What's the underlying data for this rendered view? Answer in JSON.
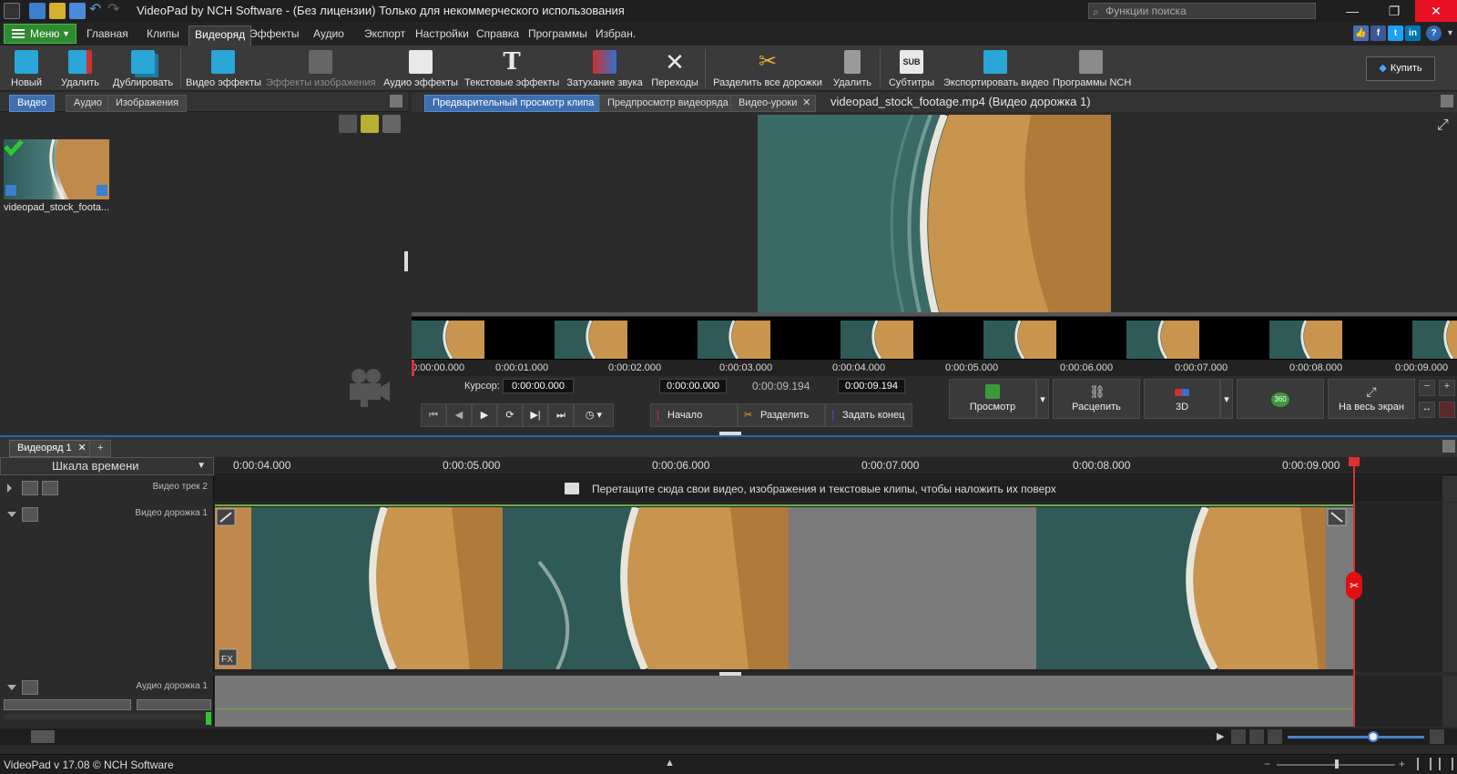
{
  "window": {
    "title": "VideoPad by NCH Software - (Без лицензии) Только для некоммерческого использования",
    "search_placeholder": "Функции поиска"
  },
  "menu": {
    "menu_button": "Меню",
    "tabs": [
      "Главная",
      "Клипы",
      "Видеоряд",
      "Эффекты",
      "Аудио",
      "Экспорт",
      "Настройки",
      "Справка",
      "Программы",
      "Избран."
    ],
    "active_tab": "Видеоряд"
  },
  "toolbar": {
    "items": [
      {
        "label": "Новый",
        "icon": "new-icon",
        "enabled": true
      },
      {
        "label": "Удалить",
        "icon": "delete-icon",
        "enabled": true
      },
      {
        "label": "Дублировать",
        "icon": "duplicate-icon",
        "enabled": true
      },
      {
        "label": "Видео эффекты",
        "icon": "video-effects-icon",
        "enabled": true
      },
      {
        "label": "Эффекты изображения",
        "icon": "image-effects-icon",
        "enabled": false
      },
      {
        "label": "Аудио эффекты",
        "icon": "audio-effects-icon",
        "enabled": true
      },
      {
        "label": "Текстовые эффекты",
        "icon": "text-effects-icon",
        "enabled": true
      },
      {
        "label": "Затухание звука",
        "icon": "fade-icon",
        "enabled": true
      },
      {
        "label": "Переходы",
        "icon": "transitions-icon",
        "enabled": true
      },
      {
        "label": "Разделить все дорожки",
        "icon": "scissors-icon",
        "enabled": true
      },
      {
        "label": "Удалить",
        "icon": "trash-icon",
        "enabled": true
      },
      {
        "label": "Субтитры",
        "icon": "subtitles-icon",
        "enabled": true
      },
      {
        "label": "Экспортировать видео",
        "icon": "export-icon",
        "enabled": true
      },
      {
        "label": "Программы NCH",
        "icon": "nch-suite-icon",
        "enabled": true
      }
    ],
    "buy_label": "Купить"
  },
  "bin": {
    "tabs": [
      "Видео",
      "Аудио",
      "Изображения"
    ],
    "active_tab": "Видео",
    "clips": [
      {
        "name": "videopad_stock_foota..."
      }
    ]
  },
  "preview": {
    "tabs": [
      "Предварительный просмотр клипа",
      "Предпросмотр видеоряда",
      "Видео-уроки"
    ],
    "active_tab": "Предварительный просмотр клипа",
    "clip_title": "videopad_stock_footage.mp4 (Видео дорожка 1)",
    "ruler_ticks": [
      "0:00:00.000",
      "0:00:01.000",
      "0:00:02.000",
      "0:00:03.000",
      "0:00:04.000",
      "0:00:05.000",
      "0:00:06.000",
      "0:00:07.000",
      "0:00:08.000",
      "0:00:09.000"
    ],
    "cursor_label": "Курсор:",
    "cursor_value": "0:00:00.000",
    "in_value": "0:00:00.000",
    "duration_value": "0:00:09.194",
    "out_value": "0:00:09.194",
    "mark_in": "Начало",
    "split": "Разделить",
    "mark_out": "Задать конец",
    "big_buttons": [
      "Просмотр",
      "Расцепить",
      "3D",
      "360",
      "На весь экран"
    ]
  },
  "timeline": {
    "tab": "Видеоряд 1",
    "add_tab": "+",
    "scale_label": "Шкала времени",
    "ticks": [
      "0:00:04.000",
      "0:00:05.000",
      "0:00:06.000",
      "0:00:07.000",
      "0:00:08.000",
      "0:00:09.000"
    ],
    "track2_name": "Видео трек 2",
    "drop_hint": "Перетащите сюда свои видео, изображения и текстовые клипы, чтобы наложить их поверх",
    "track1_name": "Видео дорожка 1",
    "audio1_name": "Аудио дорожка 1",
    "fx_label": "FX"
  },
  "status": {
    "text": "VideoPad v 17.08 © NCH Software"
  },
  "colors": {
    "accent": "#3e6fb0",
    "menu_green": "#2e8b2e",
    "playhead": "#e03030"
  }
}
